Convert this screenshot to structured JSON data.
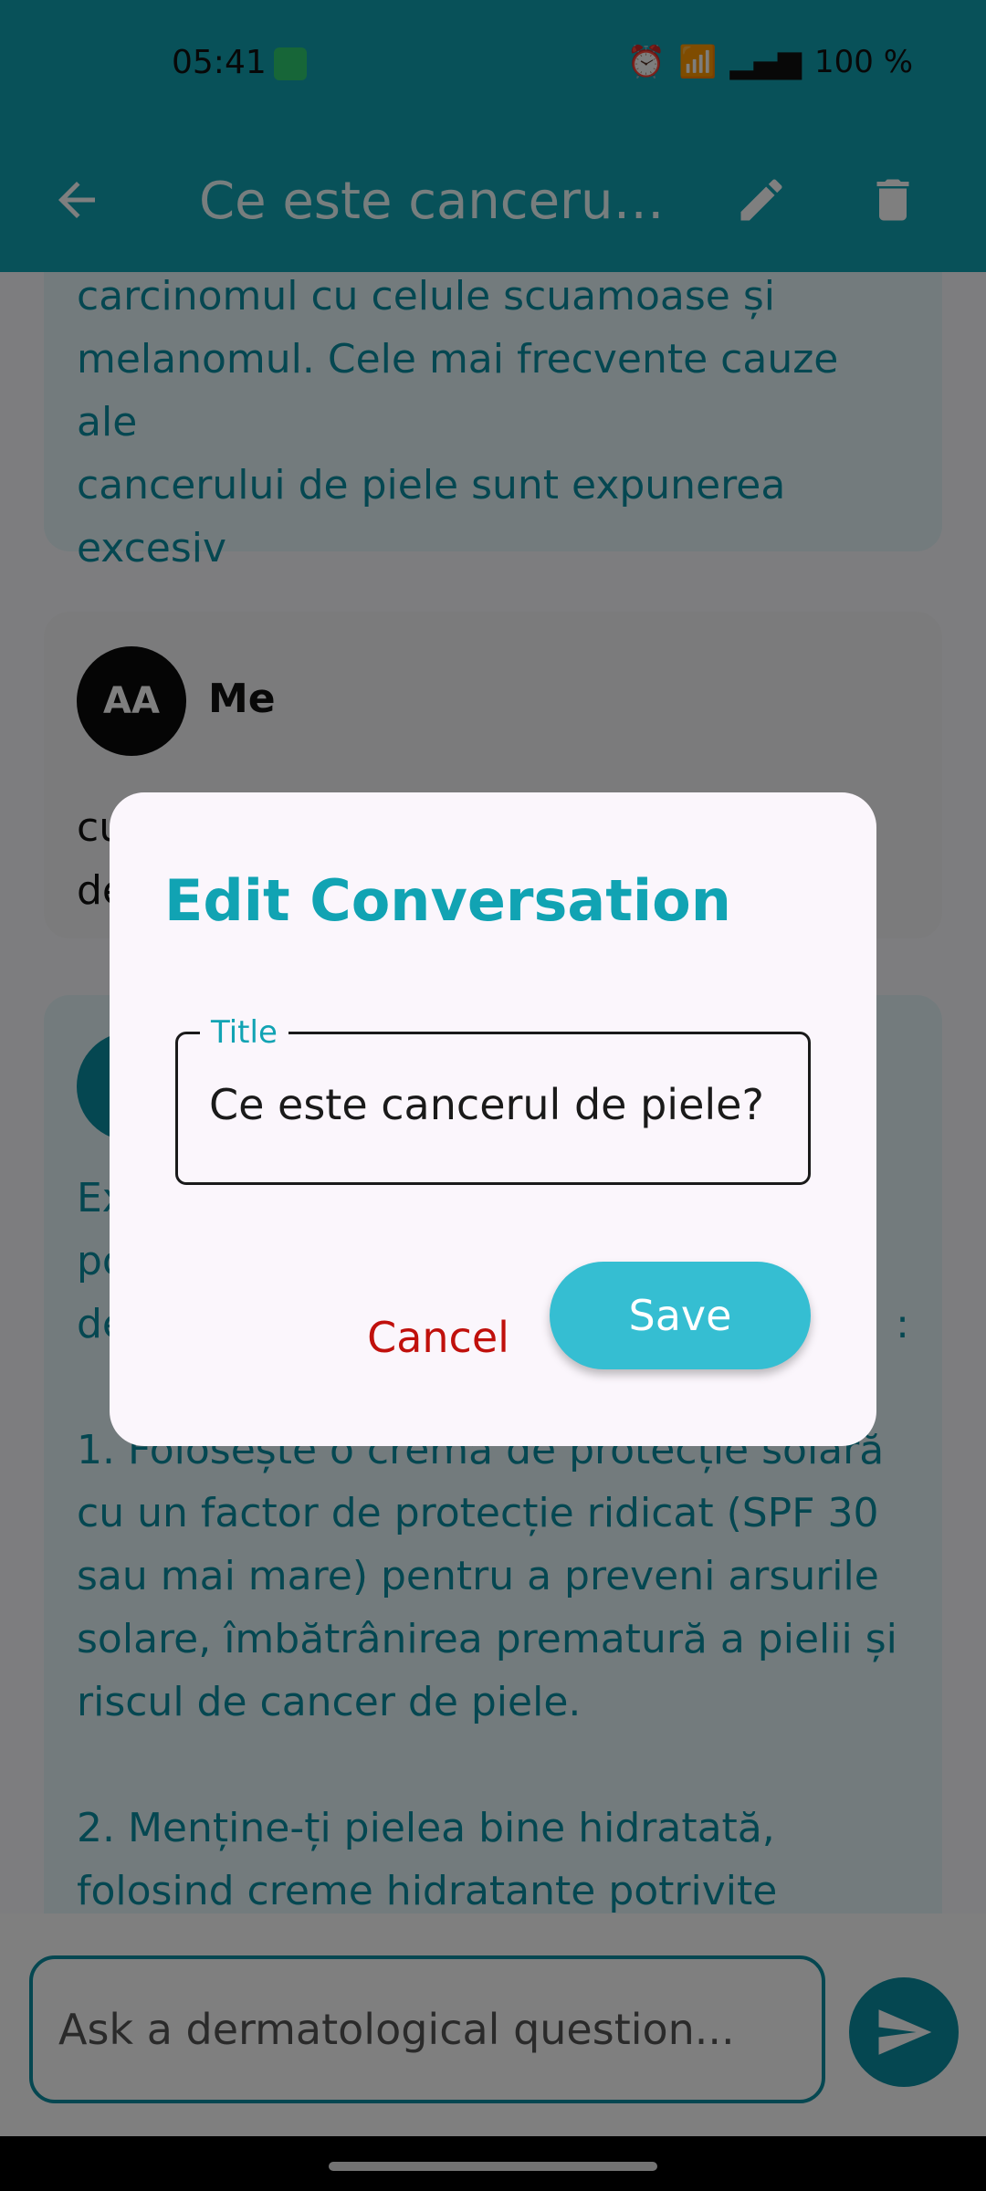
{
  "status_bar": {
    "time": "05:41",
    "battery": "100 %"
  },
  "app_bar": {
    "title": "Ce este cancerul de piele?",
    "back_icon": "arrow-left-icon",
    "edit_icon": "pencil-icon",
    "delete_icon": "trash-icon"
  },
  "messages": {
    "bot_1_lines": [
      "carcinomul cu celule scuamoase și",
      "melanomul. Cele mai frecvente cauze ale",
      "cancerului de piele sunt expunerea",
      "excesiv"
    ],
    "user_name": "Me",
    "user_avatar": "AA",
    "user_lines": [
      "cu",
      "de"
    ],
    "bot_2_lines": [
      "Ex",
      "po",
      "de",
      ":",
      "",
      "1. Folosește o cremă de protecție solară",
      "cu un factor de protecție ridicat (SPF 30",
      "sau mai mare) pentru a preveni arsurile",
      "solare, îmbătrânirea prematură a pielii și",
      "riscul de cancer de piele.",
      "",
      "2. Menține-ți pielea bine hidratată,",
      "folosind creme hidratante potrivite"
    ]
  },
  "input": {
    "placeholder": "Ask a dermatological question..."
  },
  "dialog": {
    "title": "Edit Conversation",
    "field_label": "Title",
    "field_value": "Ce este cancerul de piele?",
    "cancel": "Cancel",
    "save": "Save"
  },
  "colors": {
    "primary": "#11a3b3",
    "accent_text": "#0b8fa2",
    "danger": "#c0100c",
    "save_bg": "#35bed2"
  }
}
